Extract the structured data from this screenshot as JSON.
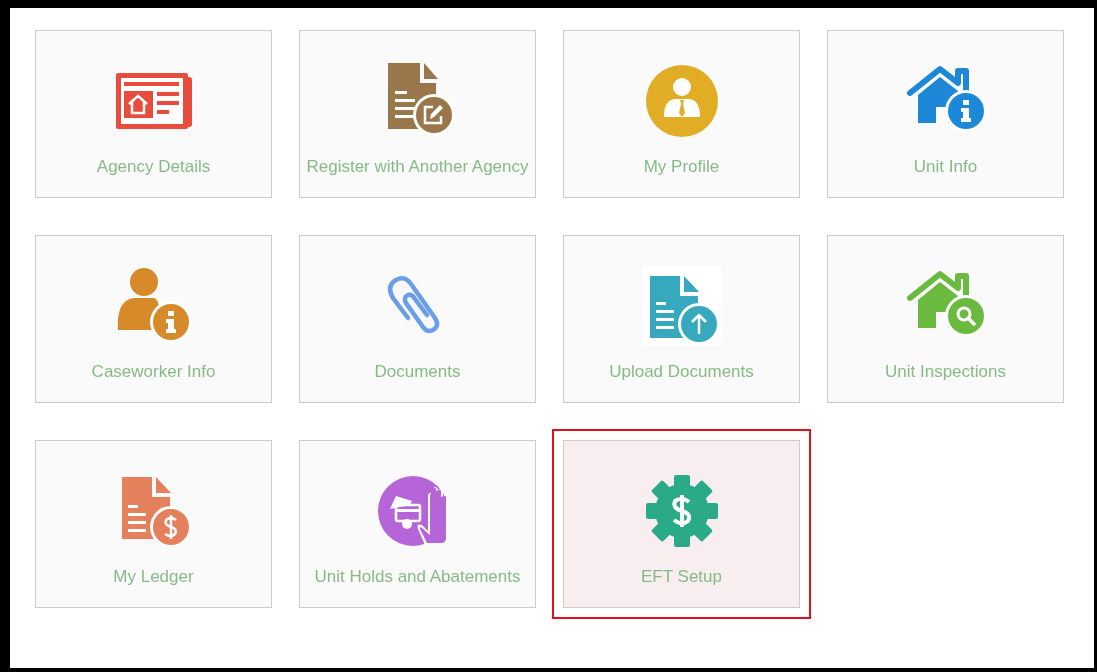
{
  "tiles": [
    {
      "label": "Agency Details",
      "selected": false
    },
    {
      "label": "Register with Another Agency",
      "selected": false
    },
    {
      "label": "My Profile",
      "selected": false
    },
    {
      "label": "Unit Info",
      "selected": false
    },
    {
      "label": "Caseworker Info",
      "selected": false
    },
    {
      "label": "Documents",
      "selected": false
    },
    {
      "label": "Upload Documents",
      "selected": false
    },
    {
      "label": "Unit Inspections",
      "selected": false
    },
    {
      "label": "My Ledger",
      "selected": false
    },
    {
      "label": "Unit Holds and Abatements",
      "selected": false
    },
    {
      "label": "EFT Setup",
      "selected": true
    }
  ]
}
